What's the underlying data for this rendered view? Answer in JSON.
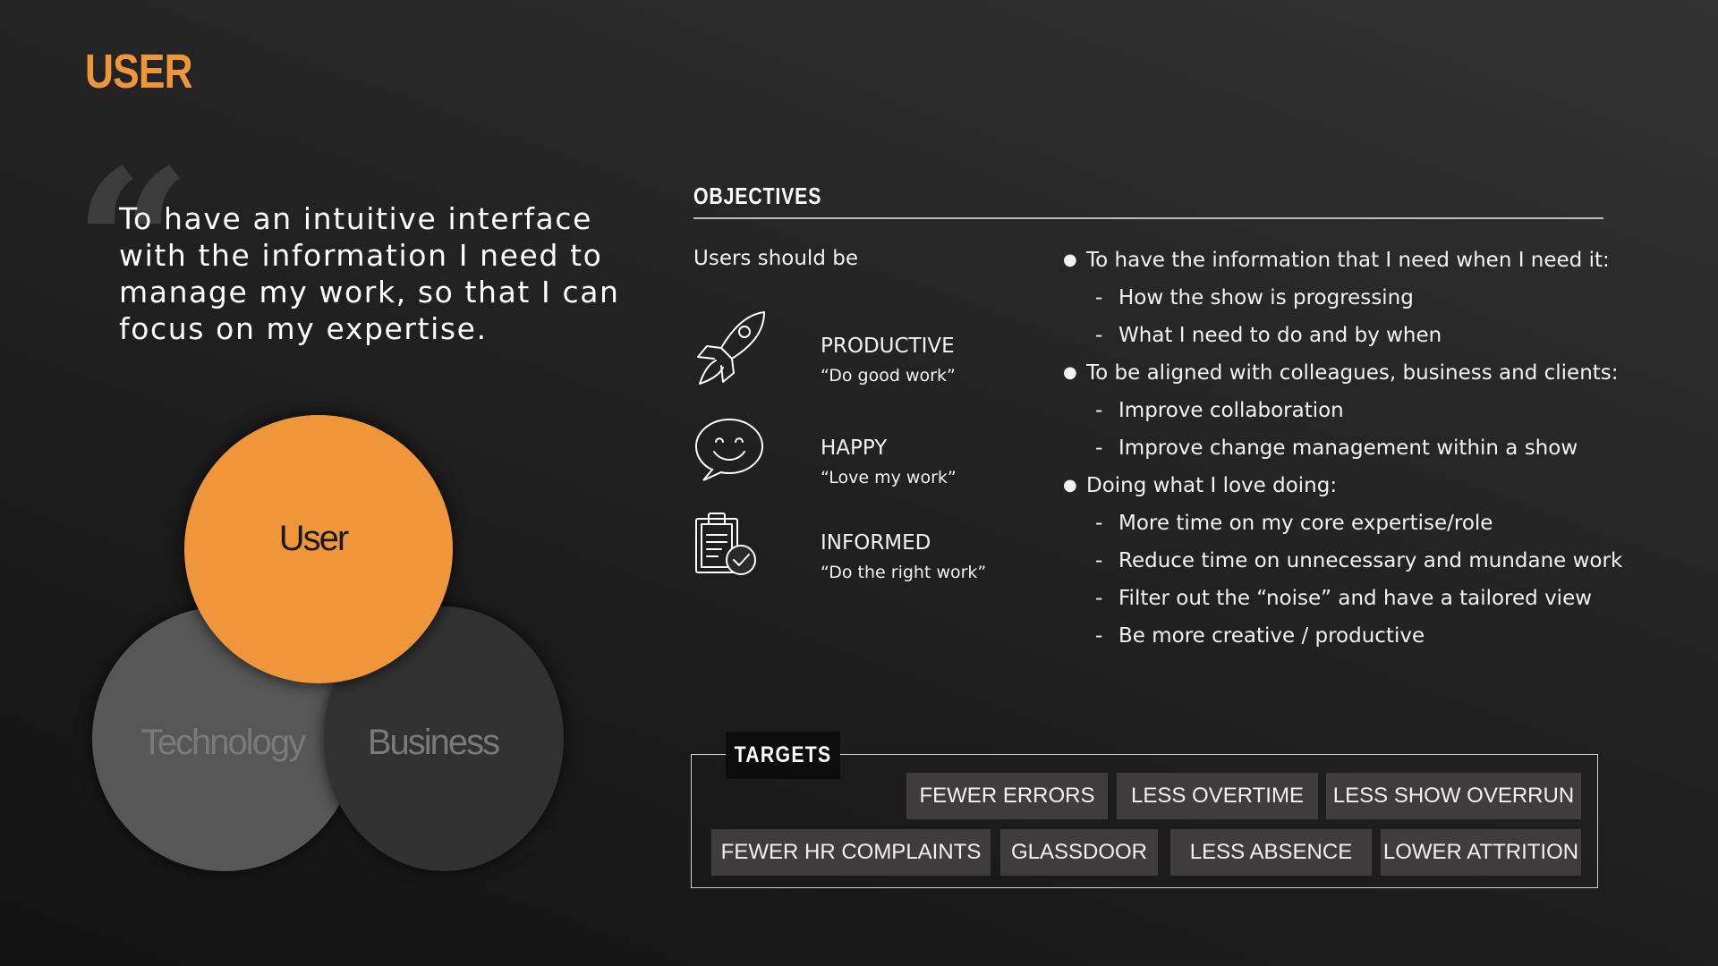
{
  "page": {
    "title": "USER"
  },
  "quote": {
    "mark": "“",
    "text": "To have an intuitive interface with the information I need to manage my work, so that I can focus on my expertise."
  },
  "venn": {
    "top": "User",
    "left": "Technology",
    "right": "Business"
  },
  "objectives": {
    "heading": "OBJECTIVES",
    "intro": "Users should be",
    "goals": [
      {
        "icon": "rocket-icon",
        "title": "PRODUCTIVE",
        "subtitle": "“Do good work”"
      },
      {
        "icon": "smiley-speech-bubble-icon",
        "title": "HAPPY",
        "subtitle": "“Love my work”"
      },
      {
        "icon": "clipboard-check-icon",
        "title": "INFORMED",
        "subtitle": "“Do the right work”"
      }
    ],
    "bullets": [
      {
        "level": 1,
        "text": "To have the information that I need when I need it:"
      },
      {
        "level": 2,
        "text": "How the show is progressing"
      },
      {
        "level": 2,
        "text": "What I need to do and by when"
      },
      {
        "level": 1,
        "text": "To be aligned with colleagues, business and clients:"
      },
      {
        "level": 2,
        "text": "Improve collaboration"
      },
      {
        "level": 2,
        "text": "Improve change management within a show"
      },
      {
        "level": 1,
        "text": "Doing what I love doing:"
      },
      {
        "level": 2,
        "text": "More time on my core expertise/role"
      },
      {
        "level": 2,
        "text": "Reduce time on unnecessary and mundane work"
      },
      {
        "level": 2,
        "text": "Filter out the “noise” and have a tailored view"
      },
      {
        "level": 2,
        "text": "Be more creative / productive"
      }
    ]
  },
  "targets": {
    "label": "TARGETS",
    "items": [
      "FEWER ERRORS",
      "LESS OVERTIME",
      "LESS SHOW OVERRUN",
      "FEWER HR COMPLAINTS",
      "GLASSDOOR",
      "LESS ABSENCE",
      "LOWER ATTRITION"
    ]
  },
  "colors": {
    "accent": "#f0963a",
    "chip": "#3f3c3d",
    "technology": "#585757",
    "business": "#323131"
  }
}
